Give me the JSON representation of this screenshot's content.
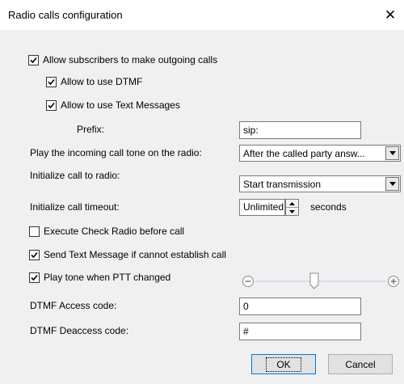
{
  "window": {
    "title": "Radio calls configuration",
    "close_glyph": "✕"
  },
  "checkboxes": {
    "allow_outgoing": {
      "label": "Allow subscribers to make outgoing calls",
      "checked": true
    },
    "allow_dtmf": {
      "label": "Allow to use DTMF",
      "checked": true
    },
    "allow_text": {
      "label": "Allow to use Text Messages",
      "checked": true
    },
    "check_radio": {
      "label": "Execute Check Radio before call",
      "checked": false
    },
    "send_text": {
      "label": "Send Text Message if cannot establish call",
      "checked": true
    },
    "play_tone": {
      "label": "Play tone when PTT changed",
      "checked": true
    }
  },
  "prefix": {
    "label": "Prefix:",
    "value": "sip:"
  },
  "incoming_tone": {
    "label": "Play the incoming call tone on the radio:",
    "value": "After the called party answ..."
  },
  "init_call": {
    "label": "Initialize call to radio:",
    "value": "Start transmission"
  },
  "timeout": {
    "label": "Initialize call timeout:",
    "value": "Unlimited",
    "unit": "seconds"
  },
  "volume_slider": {
    "level": 0.45,
    "minus_icon": "minus-circle-icon",
    "plus_icon": "plus-circle-icon"
  },
  "dtmf_access": {
    "label": "DTMF Access code:",
    "value": "0"
  },
  "dtmf_deaccess": {
    "label": "DTMF Deaccess code:",
    "value": "#"
  },
  "buttons": {
    "ok": "OK",
    "cancel": "Cancel"
  },
  "colors": {
    "background": "#f0f0f0",
    "accent": "#0078d7",
    "slider_track": "#d8d0ee"
  }
}
